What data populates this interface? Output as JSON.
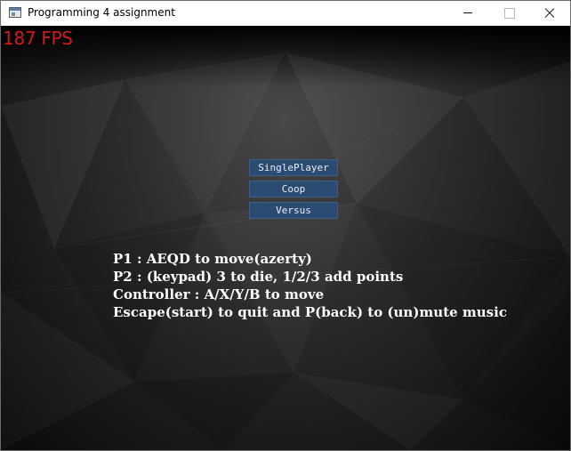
{
  "window": {
    "title": "Programming 4 assignment"
  },
  "hud": {
    "fps": "187 FPS",
    "fps_color": "#d21818"
  },
  "menu": {
    "buttons": [
      "SinglePlayer",
      "Coop",
      "Versus"
    ],
    "button_color": "#2c4b73"
  },
  "instructions": [
    "P1 : AEQD to move(azerty)",
    "P2 : (keypad) 3 to die, 1/2/3 add points",
    "Controller : A/X/Y/B to move",
    "Escape(start) to quit and P(back) to (un)mute music"
  ]
}
